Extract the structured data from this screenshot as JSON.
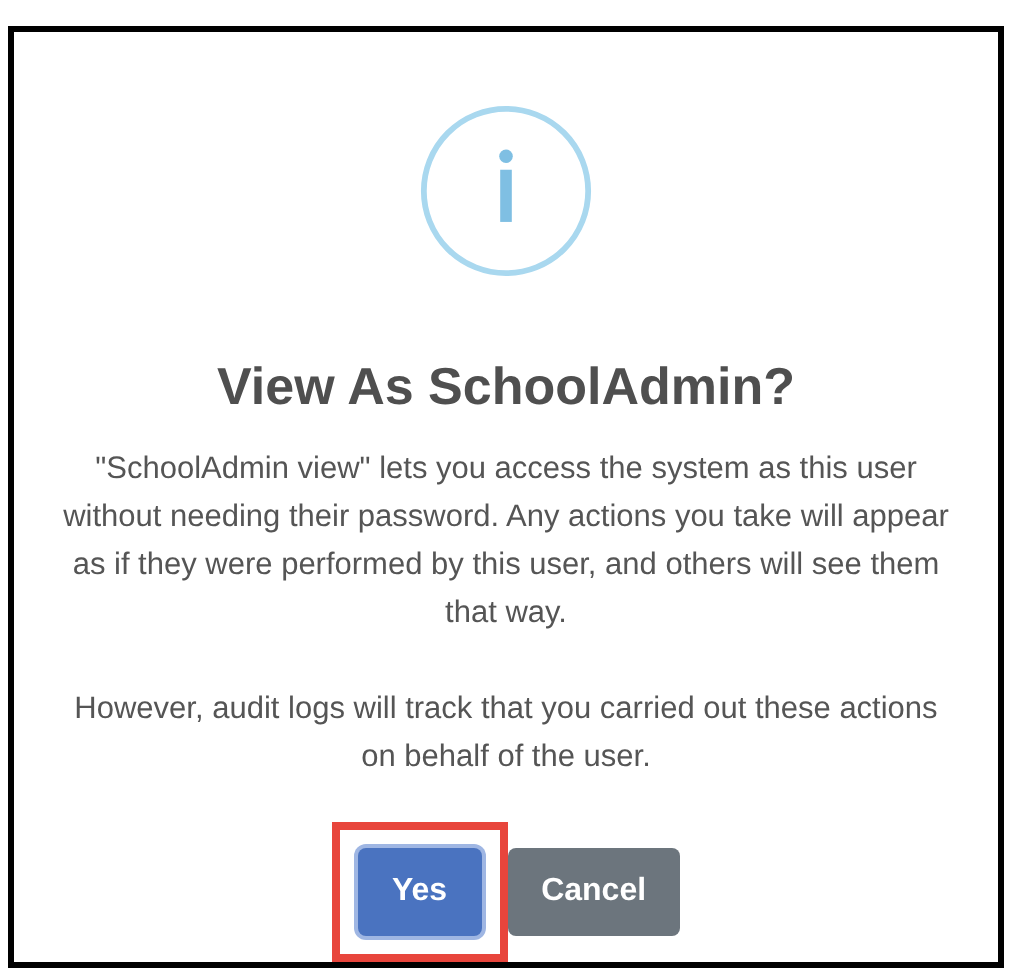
{
  "dialog": {
    "title": "View As SchoolAdmin?",
    "paragraphs": [
      "\"SchoolAdmin view\" lets you access the system as this user without needing their password. Any actions you take will appear as if they were performed by this user, and others will see them that way.",
      "However, audit logs will track that you carried out these actions on behalf of the user."
    ],
    "buttons": [
      {
        "label": "Yes",
        "kind": "primary",
        "highlighted": true
      },
      {
        "label": "Cancel",
        "kind": "secondary",
        "highlighted": false
      }
    ]
  }
}
